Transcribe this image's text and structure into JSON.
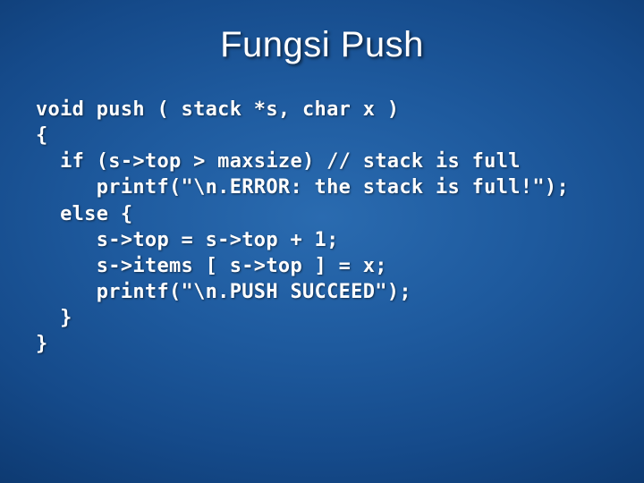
{
  "slide": {
    "title": "Fungsi Push",
    "code_lines": [
      "void push ( stack *s, char x )",
      "{",
      "  if (s->top > maxsize) // stack is full",
      "     printf(\"\\n.ERROR: the stack is full!\");",
      "  else {",
      "     s->top = s->top + 1;",
      "     s->items [ s->top ] = x;",
      "     printf(\"\\n.PUSH SUCCEED\");",
      "  }",
      "}"
    ]
  }
}
